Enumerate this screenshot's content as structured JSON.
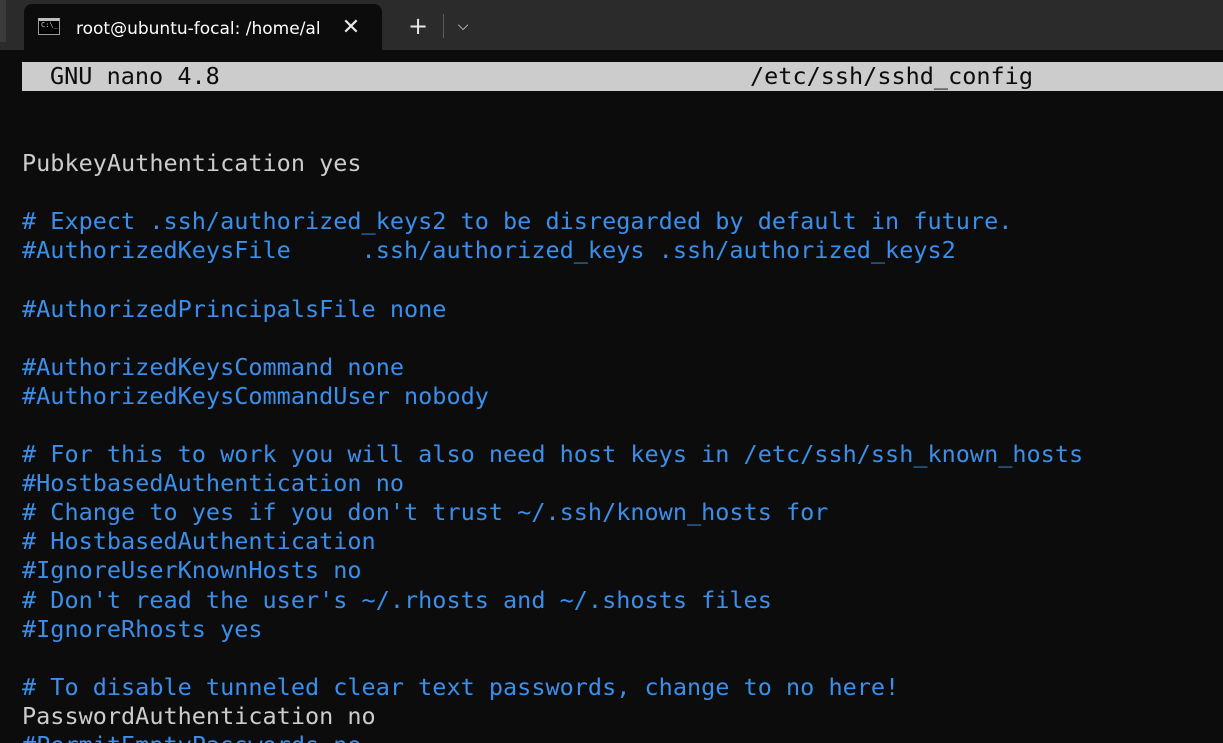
{
  "window": {
    "tab": {
      "icon": "terminal-icon",
      "icon_glyph": "C:\\_",
      "title": "root@ubuntu-focal: /home/al",
      "close_glyph": "✕"
    },
    "new_tab_glyph": "+",
    "dropdown_glyph": "⌵"
  },
  "nano": {
    "version": "GNU nano 4.8",
    "filename": "/etc/ssh/sshd_config"
  },
  "lines": [
    {
      "text": "",
      "kind": "setting"
    },
    {
      "text": "PubkeyAuthentication yes",
      "kind": "setting"
    },
    {
      "text": "",
      "kind": "setting"
    },
    {
      "text": "# Expect .ssh/authorized_keys2 to be disregarded by default in future.",
      "kind": "comment"
    },
    {
      "text": "#AuthorizedKeysFile     .ssh/authorized_keys .ssh/authorized_keys2",
      "kind": "comment"
    },
    {
      "text": "",
      "kind": "setting"
    },
    {
      "text": "#AuthorizedPrincipalsFile none",
      "kind": "comment"
    },
    {
      "text": "",
      "kind": "setting"
    },
    {
      "text": "#AuthorizedKeysCommand none",
      "kind": "comment"
    },
    {
      "text": "#AuthorizedKeysCommandUser nobody",
      "kind": "comment"
    },
    {
      "text": "",
      "kind": "setting"
    },
    {
      "text": "# For this to work you will also need host keys in /etc/ssh/ssh_known_hosts",
      "kind": "comment"
    },
    {
      "text": "#HostbasedAuthentication no",
      "kind": "comment"
    },
    {
      "text": "# Change to yes if you don't trust ~/.ssh/known_hosts for",
      "kind": "comment"
    },
    {
      "text": "# HostbasedAuthentication",
      "kind": "comment"
    },
    {
      "text": "#IgnoreUserKnownHosts no",
      "kind": "comment"
    },
    {
      "text": "# Don't read the user's ~/.rhosts and ~/.shosts files",
      "kind": "comment"
    },
    {
      "text": "#IgnoreRhosts yes",
      "kind": "comment"
    },
    {
      "text": "",
      "kind": "setting"
    },
    {
      "text": "# To disable tunneled clear text passwords, change to no here!",
      "kind": "comment"
    },
    {
      "text": "PasswordAuthentication no",
      "kind": "setting"
    },
    {
      "text": "#PermitEmptyPasswords no",
      "kind": "comment"
    }
  ],
  "colors": {
    "background": "#0c0c0c",
    "foreground": "#cccccc",
    "comment": "#3b8eea",
    "titlebar": "#2b2b2b"
  }
}
